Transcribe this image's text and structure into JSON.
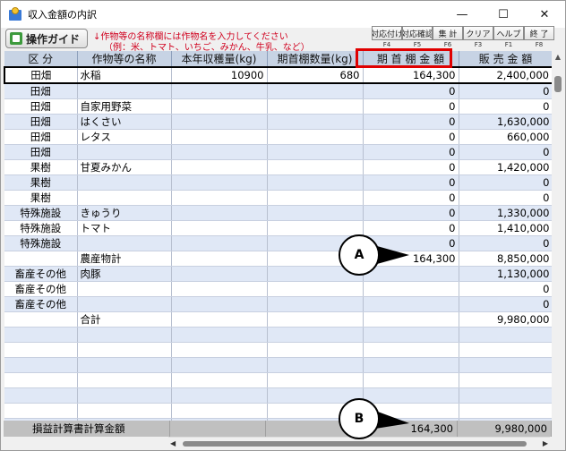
{
  "window": {
    "title": "収入金額の内訳",
    "minimize": "—",
    "maximize": "☐",
    "close": "✕"
  },
  "toolbar": {
    "guide_label": "操作ガイド",
    "hint_line1": "↓作物等の名称欄には作物名を入力してください",
    "hint_line2": "（例：米、トマト、いちご、みかん、牛乳、など）",
    "fkeys": [
      {
        "label": "対応付け",
        "key": "F4"
      },
      {
        "label": "対応確認",
        "key": "F5"
      },
      {
        "label": "集 計",
        "key": "F6"
      },
      {
        "label": "クリア",
        "key": "F3"
      },
      {
        "label": "ヘルプ",
        "key": "F1"
      },
      {
        "label": "終 了",
        "key": "F8"
      }
    ]
  },
  "grid": {
    "headers": [
      "区 分",
      "作物等の名称",
      "本年収穫量(kg)",
      "期首棚数量(kg)",
      "期 首 棚 金 額",
      "販 売 金 額"
    ],
    "rows": [
      [
        "田畑",
        "水稲",
        "10900",
        "680",
        "164,300",
        "2,400,000"
      ],
      [
        "田畑",
        "",
        "",
        "",
        "0",
        "0"
      ],
      [
        "田畑",
        "自家用野菜",
        "",
        "",
        "0",
        "0"
      ],
      [
        "田畑",
        "はくさい",
        "",
        "",
        "0",
        "1,630,000"
      ],
      [
        "田畑",
        "レタス",
        "",
        "",
        "0",
        "660,000"
      ],
      [
        "田畑",
        "",
        "",
        "",
        "0",
        "0"
      ],
      [
        "果樹",
        "甘夏みかん",
        "",
        "",
        "0",
        "1,420,000"
      ],
      [
        "果樹",
        "",
        "",
        "",
        "0",
        "0"
      ],
      [
        "果樹",
        "",
        "",
        "",
        "0",
        "0"
      ],
      [
        "特殊施設",
        "きゅうり",
        "",
        "",
        "0",
        "1,330,000"
      ],
      [
        "特殊施設",
        "トマト",
        "",
        "",
        "0",
        "1,410,000"
      ],
      [
        "特殊施設",
        "",
        "",
        "",
        "0",
        "0"
      ],
      [
        "",
        "農産物計",
        "",
        "",
        "164,300",
        "8,850,000"
      ],
      [
        "畜産その他",
        "肉豚",
        "",
        "",
        "",
        "1,130,000"
      ],
      [
        "畜産その他",
        "",
        "",
        "",
        "",
        "0"
      ],
      [
        "畜産その他",
        "",
        "",
        "",
        "",
        "0"
      ],
      [
        "",
        "合計",
        "",
        "",
        "",
        "9,980,000"
      ],
      [
        "",
        "",
        "",
        "",
        "",
        ""
      ],
      [
        "",
        "",
        "",
        "",
        "",
        ""
      ],
      [
        "",
        "",
        "",
        "",
        "",
        ""
      ],
      [
        "",
        "",
        "",
        "",
        "",
        ""
      ],
      [
        "",
        "",
        "",
        "",
        "",
        ""
      ],
      [
        "",
        "",
        "",
        "",
        "",
        ""
      ],
      [
        "",
        "",
        "",
        "",
        "",
        ""
      ]
    ]
  },
  "footer": {
    "label": "損益計算書計算金額",
    "opening_amount": "164,300",
    "sales_amount": "9,980,000"
  },
  "callouts": {
    "a": "A",
    "b": "B"
  }
}
